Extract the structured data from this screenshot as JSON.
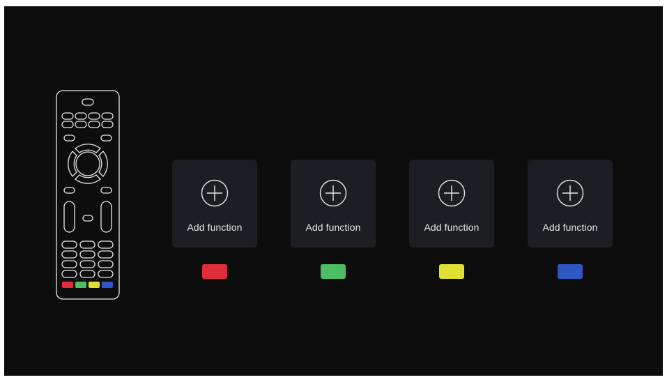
{
  "slots": [
    {
      "label": "Add function",
      "key_color": "#e12d3a"
    },
    {
      "label": "Add function",
      "key_color": "#4cbe63"
    },
    {
      "label": "Add function",
      "key_color": "#e0e032"
    },
    {
      "label": "Add function",
      "key_color": "#2f57c4"
    }
  ],
  "remote_key_colors": [
    "#e12d3a",
    "#4cbe63",
    "#e0e032",
    "#2f57c4"
  ],
  "icons": {
    "slot_icon": "plus-circle-icon",
    "remote": "remote-control-icon"
  }
}
